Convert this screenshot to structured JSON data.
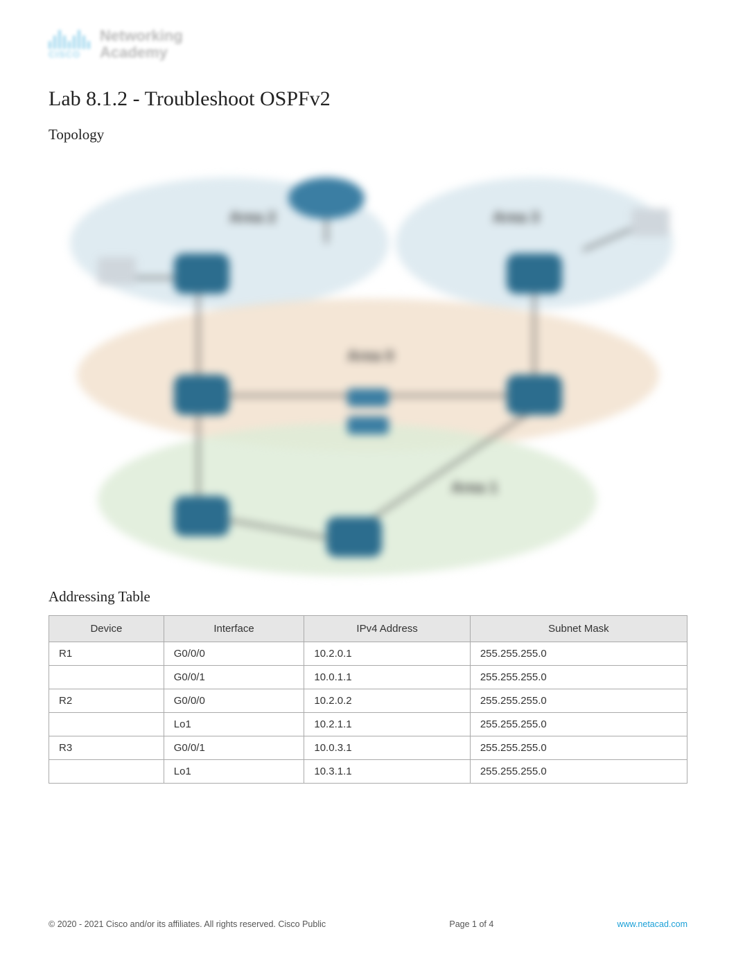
{
  "logo": {
    "brand": "CISCO",
    "program_l1": "Networking",
    "program_l2": "Academy"
  },
  "title": "Lab 8.1.2 - Troubleshoot OSPFv2",
  "sections": {
    "topology": "Topology",
    "addressing_table": "Addressing Table"
  },
  "topology_labels": {
    "area2": "Area 2",
    "area3": "Area 3",
    "area0": "Area 0",
    "area1": "Area 1"
  },
  "table": {
    "headers": [
      "Device",
      "Interface",
      "IPv4 Address",
      "Subnet Mask"
    ],
    "rows": [
      {
        "device": "R1",
        "interface": "G0/0/0",
        "ip": "10.2.0.1",
        "mask": "255.255.255.0"
      },
      {
        "device": "",
        "interface": "G0/0/1",
        "ip": "10.0.1.1",
        "mask": "255.255.255.0"
      },
      {
        "device": "R2",
        "interface": "G0/0/0",
        "ip": "10.2.0.2",
        "mask": "255.255.255.0"
      },
      {
        "device": "",
        "interface": "Lo1",
        "ip": "10.2.1.1",
        "mask": "255.255.255.0"
      },
      {
        "device": "R3",
        "interface": "G0/0/1",
        "ip": "10.0.3.1",
        "mask": "255.255.255.0"
      },
      {
        "device": "",
        "interface": "Lo1",
        "ip": "10.3.1.1",
        "mask": "255.255.255.0"
      }
    ]
  },
  "footer": {
    "copyright": "2020 - 2021 Cisco and/or its affiliates. All rights reserved. Cisco Public",
    "page": "Page  1 of 4",
    "link": "www.netacad.com"
  }
}
